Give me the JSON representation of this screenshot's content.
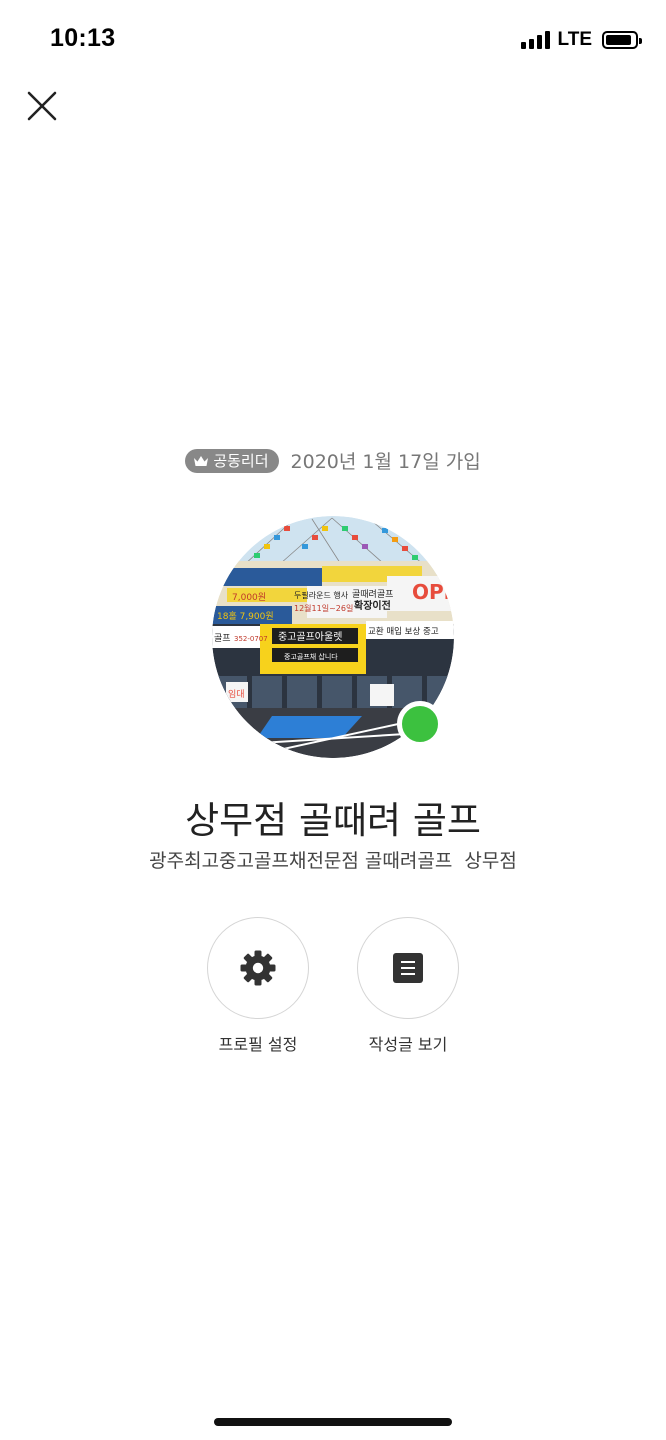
{
  "status_bar": {
    "time": "10:13",
    "network": "LTE",
    "signal_icon": "signal-bars-icon",
    "battery_icon": "battery-icon"
  },
  "header": {
    "close_icon": "close-icon"
  },
  "profile": {
    "role_badge": "공동리더",
    "role_icon": "crown-icon",
    "join_date": "2020년 1월 17일 가입",
    "name": "상무점 골때려 골프",
    "description": "광주최고중고골프채전문점 골때려골프  상무점",
    "online_status_color": "#3cc13f"
  },
  "actions": [
    {
      "label": "프로필 설정",
      "icon": "gear-icon"
    },
    {
      "label": "작성글 보기",
      "icon": "document-list-icon"
    }
  ],
  "avatar_photo": {
    "signs": {
      "main_sign": "중고골프아울렛",
      "main_sub": "중고골프채 삽니다",
      "right_sign": "교환 매입 보상 중고",
      "open_sign": "OPEN",
      "move_sign_1": "골때려골프",
      "move_sign_2": "확장이전",
      "event_sign": "두필라운드 행사",
      "event_date": "12월11일~26일",
      "price_sign": "7,000원",
      "price_sign_2": "18홀 7,900원",
      "left_sign": "골프",
      "phone": "352-0707",
      "rent_sign": "임대"
    }
  }
}
